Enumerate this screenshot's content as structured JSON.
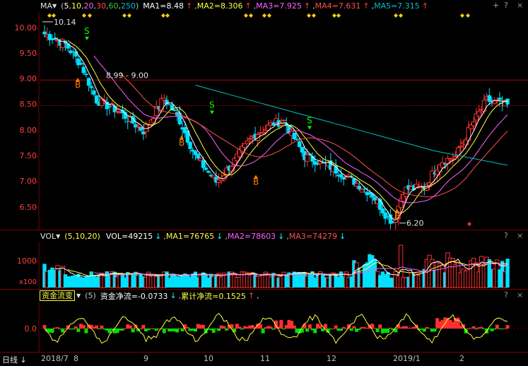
{
  "colors": {
    "up": "#ff3030",
    "down": "#00e0ff",
    "grid": "#7a0000",
    "ma5": "#ffffff",
    "ma10": "#ffff40",
    "ma20": "#ff60ff",
    "ma60": "#33cc33",
    "ma250": "#00c0c0",
    "buy": "#ff8000",
    "sell": "#00ff00",
    "arrow_up": "#ff4040",
    "arrow_down": "#00ffff"
  },
  "main_bar": {
    "ma_title": "MA",
    "periods_open": "(",
    "periods": [
      "5",
      "10",
      "20",
      "30",
      "60",
      "250"
    ],
    "periods_close": ")",
    "ma1": "MA1=8.48",
    "ma2": "MA2=8.306",
    "ma3": "MA3=7.925",
    "ma4": "MA4=7.631",
    "ma5": "MA5=7.315",
    "arrow_up": "↑",
    "arrow_down": "↓"
  },
  "price_axis": [
    "10.00",
    "9.50",
    "9.00",
    "8.50",
    "8.00",
    "7.50",
    "7.00",
    "6.50"
  ],
  "annotations": {
    "high_label": "10.14",
    "gap_label": "8.99 - 9.00",
    "low_label": "6.20",
    "buy": "B",
    "sell": "S"
  },
  "vol_bar": {
    "title": "VOL",
    "params": "(5,10,20)",
    "vol": "VOL=49215",
    "ma1": "MA1=76765",
    "ma2": "MA2=78603",
    "ma3": "MA3=74279",
    "axis_top": "1000",
    "axis_unit": "x100"
  },
  "fund_bar": {
    "title": "资金流变",
    "params": "(5)",
    "net": "资金净流=-0.0733",
    "cum": "累计净流=0.1525",
    "axis_zero": "0.0"
  },
  "controls": {
    "close": "×",
    "plus": "+",
    "help": "?"
  },
  "time_axis": {
    "period_label": "日线",
    "labels": [
      "2018/7",
      "8",
      "9",
      "10",
      "11",
      "12",
      "2019/1",
      "2"
    ]
  },
  "chart_data": {
    "type": "candlestick",
    "price_range": [
      6.1,
      10.3
    ],
    "price_ticks": [
      10.0,
      9.5,
      9.0,
      8.5,
      8.0,
      7.5,
      7.0,
      6.5
    ],
    "anchors": [
      [
        0,
        9.9
      ],
      [
        8,
        9.7
      ],
      [
        14,
        9.3
      ],
      [
        20,
        8.6
      ],
      [
        28,
        8.4
      ],
      [
        38,
        8.0
      ],
      [
        46,
        8.65
      ],
      [
        52,
        8.2
      ],
      [
        58,
        7.5
      ],
      [
        66,
        7.0
      ],
      [
        72,
        7.35
      ],
      [
        80,
        7.9
      ],
      [
        88,
        8.15
      ],
      [
        92,
        8.2
      ],
      [
        100,
        7.5
      ],
      [
        108,
        7.35
      ],
      [
        118,
        7.05
      ],
      [
        126,
        6.75
      ],
      [
        132,
        6.3
      ],
      [
        134,
        6.22
      ],
      [
        138,
        6.85
      ],
      [
        146,
        6.9
      ],
      [
        152,
        7.4
      ],
      [
        158,
        7.5
      ],
      [
        164,
        8.1
      ],
      [
        170,
        8.6
      ],
      [
        178,
        8.5
      ]
    ],
    "ma250_start": [
      58,
      8.9
    ],
    "high": 10.14,
    "low": 6.2,
    "volume_range": [
      0,
      1450
    ]
  }
}
